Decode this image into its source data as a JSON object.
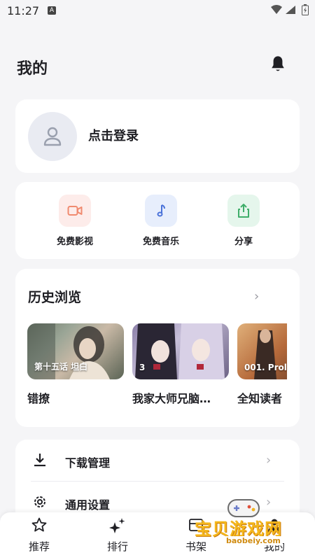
{
  "status_bar": {
    "time": "11:27",
    "notification_badge": "A"
  },
  "header": {
    "title": "我的"
  },
  "login": {
    "label": "点击登录"
  },
  "quick_actions": [
    {
      "label": "免费影视",
      "icon": "video-camera-icon",
      "bg": "#fdecea",
      "color": "#f08a6f"
    },
    {
      "label": "免费音乐",
      "icon": "music-note-icon",
      "bg": "#e7eefc",
      "color": "#4a72d9"
    },
    {
      "label": "分享",
      "icon": "share-icon",
      "bg": "#e5f6ec",
      "color": "#3fae6a"
    }
  ],
  "history": {
    "title": "历史浏览",
    "items": [
      {
        "caption": "第十五话 坦白",
        "name": "错撩"
      },
      {
        "caption": "3",
        "name": "我家大师兄脑…"
      },
      {
        "caption": "001. Prol",
        "name": "全知读者"
      }
    ]
  },
  "menu": [
    {
      "label": "下载管理",
      "icon": "download-icon"
    },
    {
      "label": "通用设置",
      "icon": "settings-gear-icon"
    }
  ],
  "bottom_nav": [
    {
      "label": "推荐",
      "icon": "star-icon"
    },
    {
      "label": "排行",
      "icon": "sparkles-icon"
    },
    {
      "label": "书架",
      "icon": "bookshelf-icon"
    },
    {
      "label": "我的",
      "icon": "profile-icon"
    }
  ],
  "watermark": {
    "text": "宝贝游戏网",
    "url": "baobeiy.com"
  }
}
